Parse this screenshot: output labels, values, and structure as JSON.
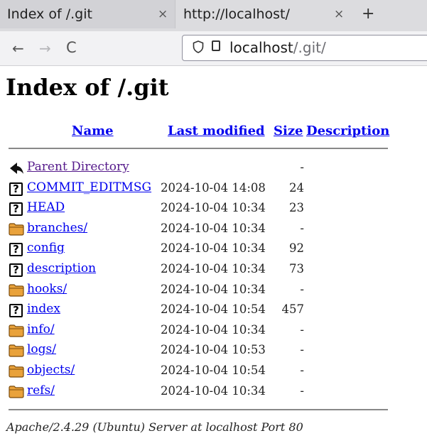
{
  "browser": {
    "tabs": [
      {
        "title": "Index of /.git",
        "active": true
      },
      {
        "title": "http://localhost/",
        "active": false
      }
    ],
    "close_glyph": "×",
    "new_tab_glyph": "+",
    "nav": {
      "back": "←",
      "forward": "→",
      "reload": "C"
    },
    "url": {
      "host": "localhost",
      "path": "/.git/"
    }
  },
  "page": {
    "title": "Index of /.git",
    "columns": {
      "name": "Name",
      "last_modified": "Last modified",
      "size": "Size",
      "description": "Description"
    },
    "entries": [
      {
        "name": "Parent Directory",
        "modified": "",
        "size": "-",
        "icon": "back-icon",
        "visited": true
      },
      {
        "name": "COMMIT_EDITMSG",
        "modified": "2024-10-04 14:08",
        "size": "24",
        "icon": "unknown-file-icon"
      },
      {
        "name": "HEAD",
        "modified": "2024-10-04 10:34",
        "size": "23",
        "icon": "unknown-file-icon"
      },
      {
        "name": "branches/",
        "modified": "2024-10-04 10:34",
        "size": "-",
        "icon": "folder-icon"
      },
      {
        "name": "config",
        "modified": "2024-10-04 10:34",
        "size": "92",
        "icon": "unknown-file-icon"
      },
      {
        "name": "description",
        "modified": "2024-10-04 10:34",
        "size": "73",
        "icon": "unknown-file-icon"
      },
      {
        "name": "hooks/",
        "modified": "2024-10-04 10:34",
        "size": "-",
        "icon": "folder-icon"
      },
      {
        "name": "index",
        "modified": "2024-10-04 10:54",
        "size": "457",
        "icon": "unknown-file-icon"
      },
      {
        "name": "info/",
        "modified": "2024-10-04 10:34",
        "size": "-",
        "icon": "folder-icon"
      },
      {
        "name": "logs/",
        "modified": "2024-10-04 10:53",
        "size": "-",
        "icon": "folder-icon"
      },
      {
        "name": "objects/",
        "modified": "2024-10-04 10:54",
        "size": "-",
        "icon": "folder-icon"
      },
      {
        "name": "refs/",
        "modified": "2024-10-04 10:34",
        "size": "-",
        "icon": "folder-icon"
      }
    ],
    "footer": "Apache/2.4.29 (Ubuntu) Server at localhost Port 80"
  },
  "colors": {
    "link": "#0000ee",
    "visited_link": "#551a8b",
    "folder": "#e9a23b"
  }
}
